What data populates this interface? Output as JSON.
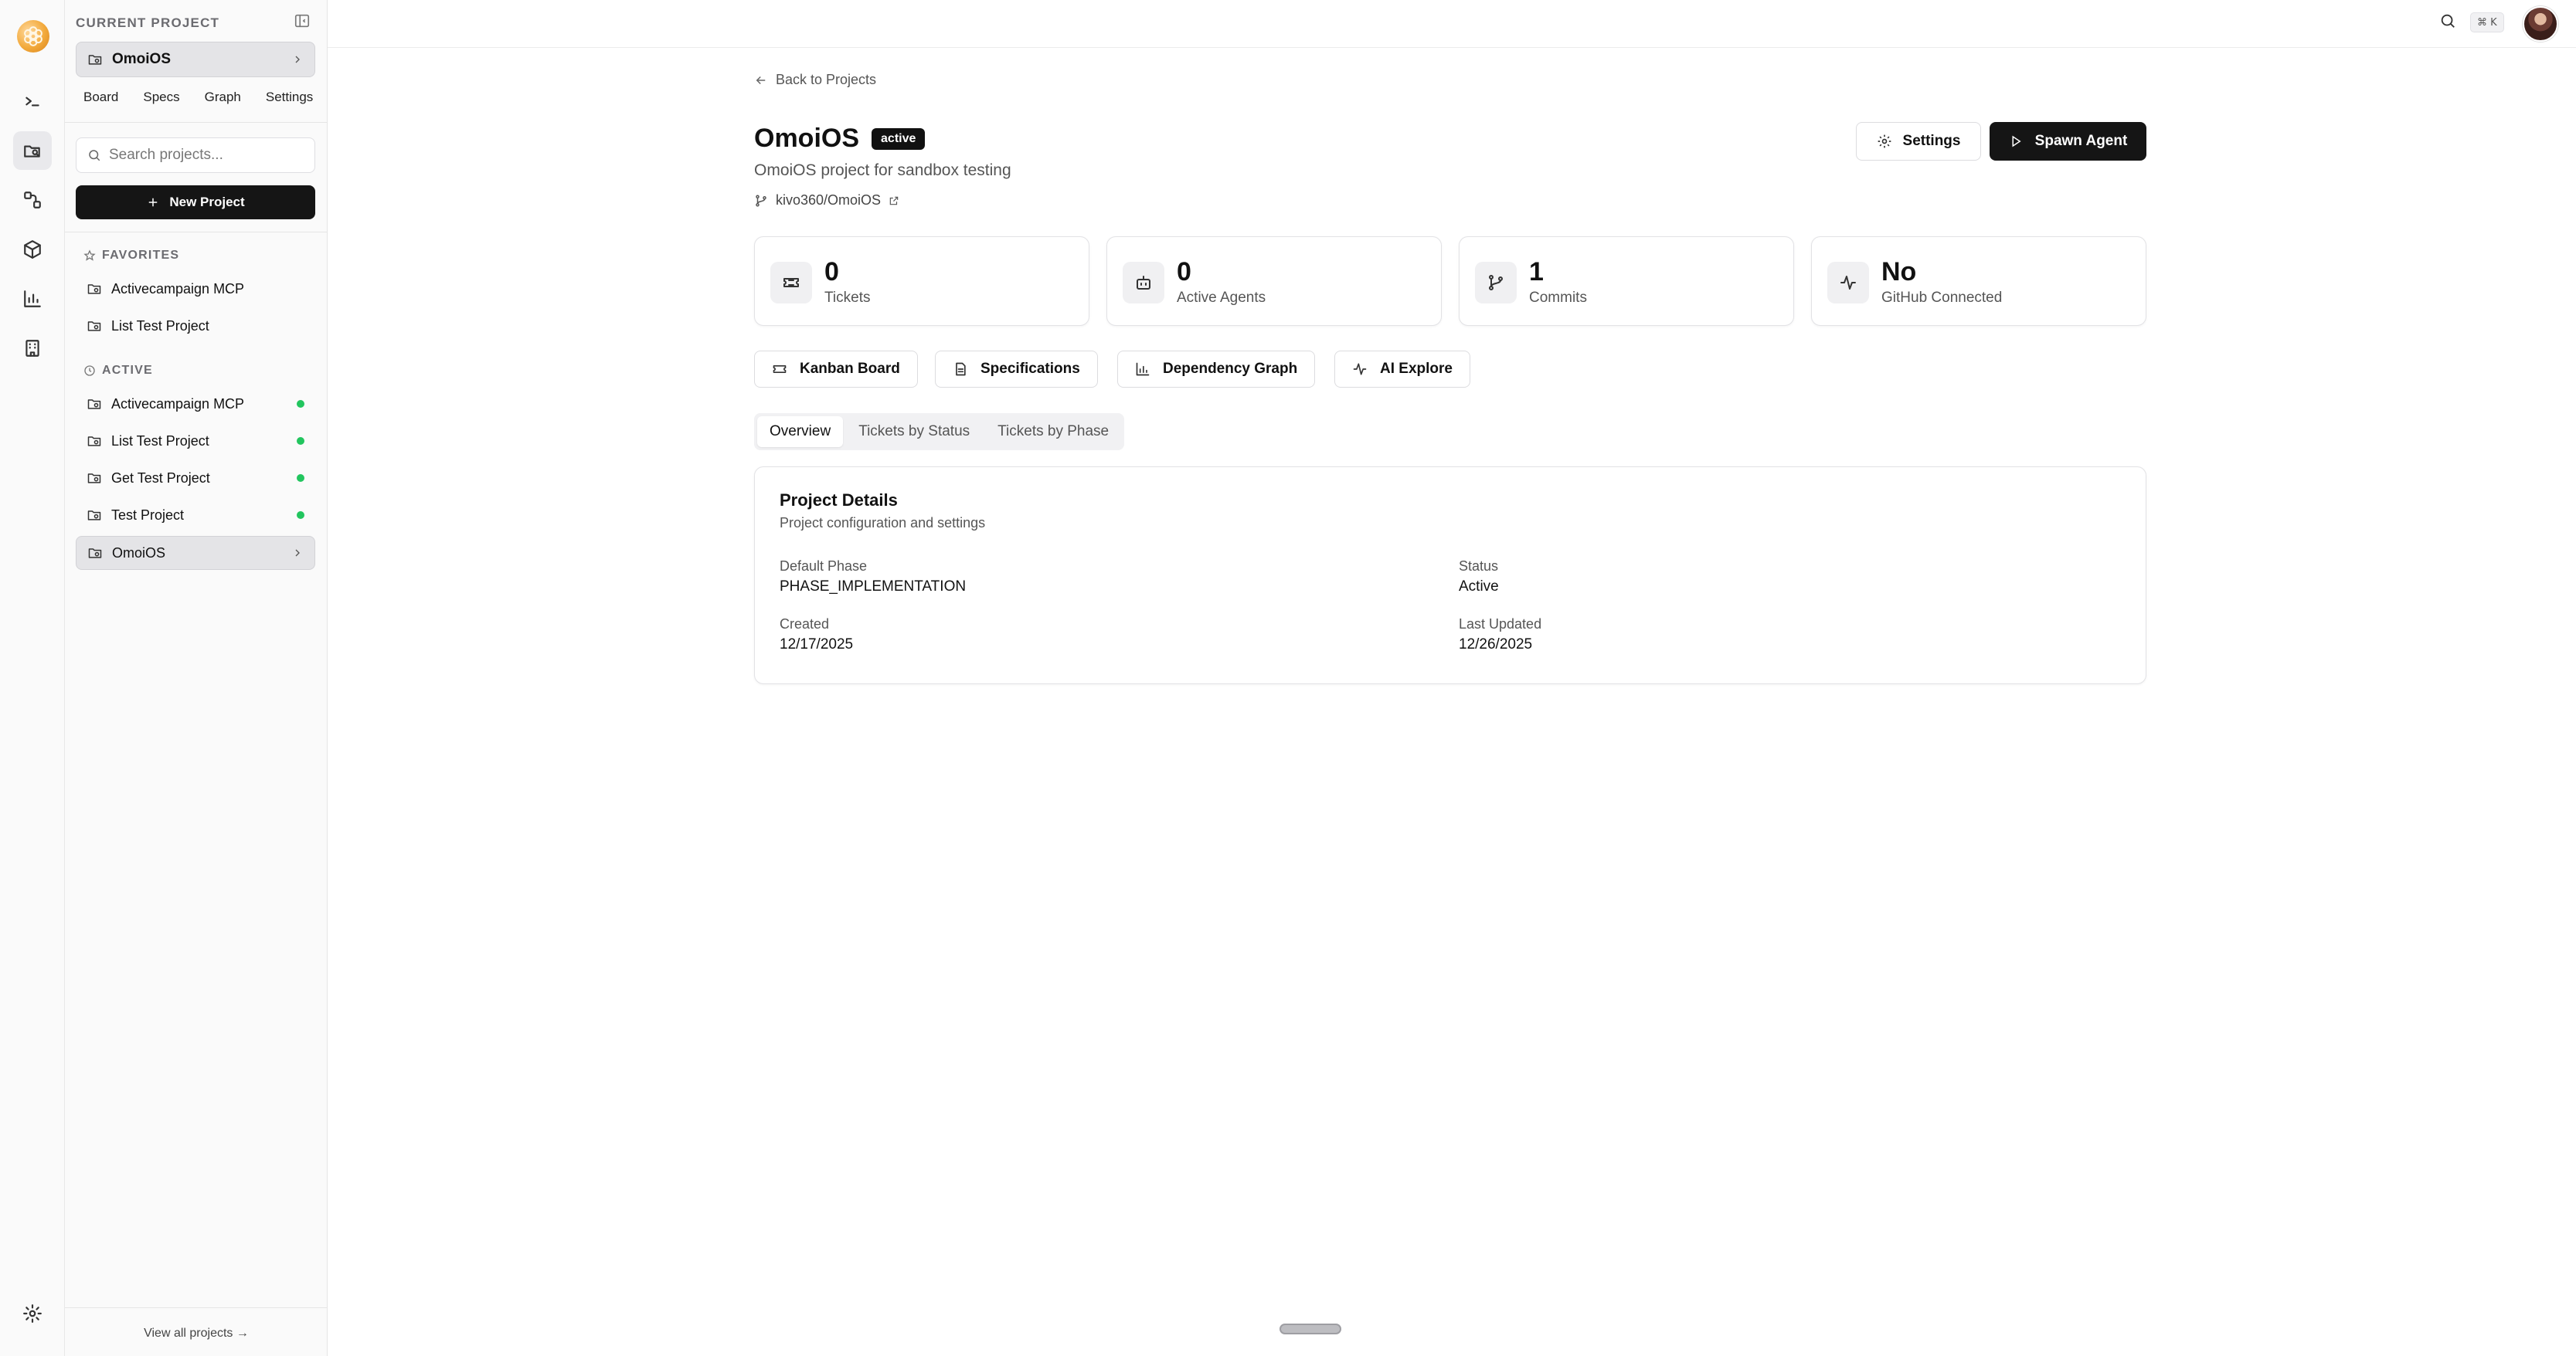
{
  "rail": {
    "logo": "logo-icon",
    "items": [
      {
        "name": "terminal-icon"
      },
      {
        "name": "projects-icon",
        "active": true
      },
      {
        "name": "workflow-icon"
      },
      {
        "name": "package-icon"
      },
      {
        "name": "analytics-icon"
      },
      {
        "name": "organization-icon"
      }
    ],
    "footer_icon": "settings-icon"
  },
  "sidebar": {
    "current_label": "CURRENT PROJECT",
    "current_project": "OmoiOS",
    "subnav": [
      "Board",
      "Specs",
      "Graph",
      "Settings"
    ],
    "search_placeholder": "Search projects...",
    "new_project_label": "New Project",
    "favorites_label": "FAVORITES",
    "favorites": [
      "Activecampaign MCP",
      "List Test Project"
    ],
    "active_label": "ACTIVE",
    "active": [
      {
        "name": "Activecampaign MCP",
        "status": "online"
      },
      {
        "name": "List Test Project",
        "status": "online"
      },
      {
        "name": "Get Test Project",
        "status": "online"
      },
      {
        "name": "Test Project",
        "status": "online"
      },
      {
        "name": "OmoiOS",
        "selected": true
      }
    ],
    "view_all": "View all projects →"
  },
  "topbar": {
    "shortcut": "⌘ K"
  },
  "project": {
    "back_label": "Back to Projects",
    "title": "OmoiOS",
    "status_badge": "active",
    "description": "OmoiOS project for sandbox testing",
    "repo": "kivo360/OmoiOS",
    "settings_label": "Settings",
    "spawn_label": "Spawn Agent"
  },
  "stats": [
    {
      "value": "0",
      "label": "Tickets",
      "icon": "ticket-icon"
    },
    {
      "value": "0",
      "label": "Active Agents",
      "icon": "bot-icon"
    },
    {
      "value": "1",
      "label": "Commits",
      "icon": "git-branch-icon"
    },
    {
      "value": "No",
      "label": "GitHub Connected",
      "icon": "activity-icon"
    }
  ],
  "quick_links": [
    "Kanban Board",
    "Specifications",
    "Dependency Graph",
    "AI Explore"
  ],
  "tabs": [
    "Overview",
    "Tickets by Status",
    "Tickets by Phase"
  ],
  "details": {
    "title": "Project Details",
    "subtitle": "Project configuration and settings",
    "default_phase_label": "Default Phase",
    "default_phase": "PHASE_IMPLEMENTATION",
    "status_label": "Status",
    "status": "Active",
    "created_label": "Created",
    "created": "12/17/2025",
    "updated_label": "Last Updated",
    "updated": "12/26/2025"
  },
  "colors": {
    "accent": "#151515",
    "status_online": "#22c55e"
  }
}
